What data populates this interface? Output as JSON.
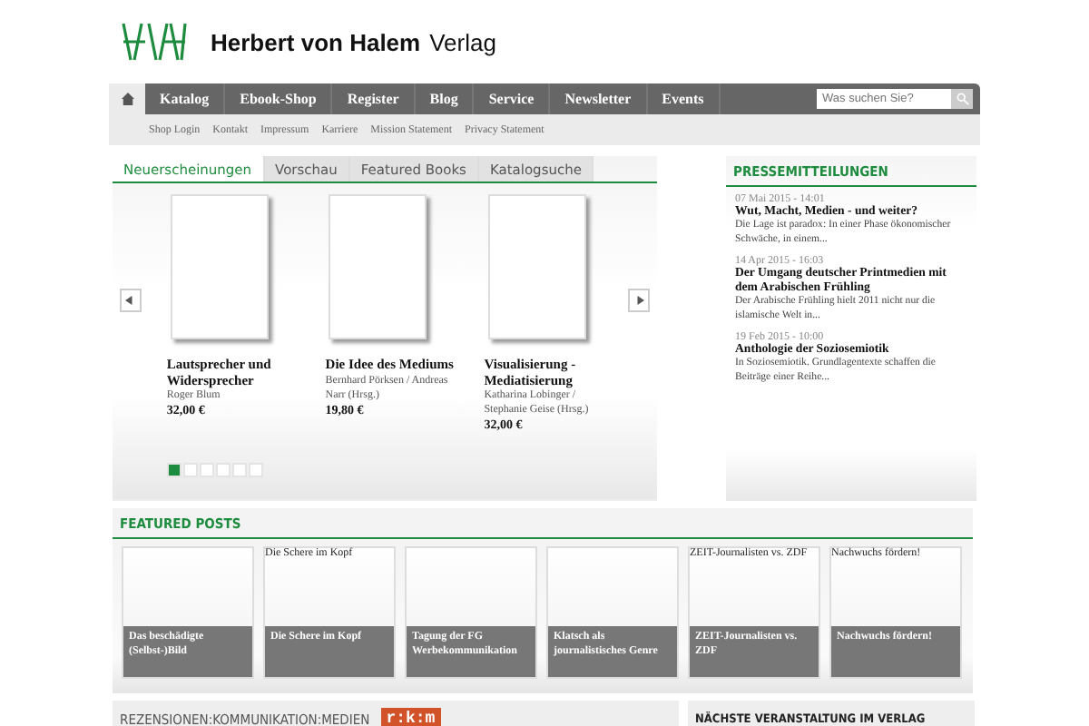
{
  "logo": {
    "name_bold": "Herbert von Halem",
    "name_light": "Verlag"
  },
  "nav": {
    "items": [
      {
        "label": "Katalog"
      },
      {
        "label": "Ebook-Shop"
      },
      {
        "label": "Register"
      },
      {
        "label": "Blog"
      },
      {
        "label": "Service"
      },
      {
        "label": "Newsletter"
      },
      {
        "label": "Events"
      }
    ],
    "search_placeholder": "Was suchen Sie?"
  },
  "subnav": [
    "Shop Login",
    "Kontakt",
    "Impressum",
    "Karriere",
    "Mission Statement",
    "Privacy Statement"
  ],
  "tabs": [
    {
      "label": "Neuerscheinungen",
      "selected": true
    },
    {
      "label": "Vorschau",
      "selected": false
    },
    {
      "label": "Featured Books",
      "selected": false
    },
    {
      "label": "Katalogsuche",
      "selected": false
    }
  ],
  "books": [
    {
      "title": "Lautsprecher und Widersprecher",
      "author": "Roger Blum",
      "price": "32,00 €"
    },
    {
      "title": "Die Idee des Mediums",
      "author": "Bernhard Pörksen / Andreas Narr (Hrsg.)",
      "price": "19,80 €"
    },
    {
      "title": "Visualisierung - Mediatisierung",
      "author": "Katharina Lobinger / Stephanie Geise (Hrsg.)",
      "price": "32,00 €"
    }
  ],
  "pager": [
    {
      "selected": true
    },
    {
      "selected": false
    },
    {
      "selected": false
    },
    {
      "selected": false
    },
    {
      "selected": false
    },
    {
      "selected": false
    }
  ],
  "press": {
    "title": "PRESSEMITTEILUNGEN",
    "items": [
      {
        "date": "07 Mai 2015 - 14:01",
        "title": "Wut, Macht, Medien - und weiter?",
        "text": "Die Lage ist paradox: In einer Phase ökonomischer Schwäche, in einem..."
      },
      {
        "date": "14 Apr 2015 - 16:03",
        "title": "Der Umgang deutscher Printmedien mit dem Arabischen Frühling",
        "text": "Der Arabische Frühling hielt 2011 nicht nur die islamische Welt in..."
      },
      {
        "date": "19 Feb 2015 - 10:00",
        "title": "Anthologie der Soziosemiotik",
        "text": "In Soziosemiotik. Grundlagentexte schaffen die Beiträge einer Reihe..."
      }
    ]
  },
  "featured": {
    "title": "FEATURED POSTS",
    "posts": [
      {
        "caption": "Das beschädigte (Selbst-)Bild"
      },
      {
        "alt": "Die Schere im Kopf",
        "caption": "Die Schere im Kopf"
      },
      {
        "caption": "Tagung der FG Werbekommunikation"
      },
      {
        "caption": "Klatsch als journalistisches Genre"
      },
      {
        "alt": "ZEIT-Journalisten vs. ZDF",
        "caption": "ZEIT-Journalisten vs. ZDF"
      },
      {
        "alt": "Nachwuchs fördern!",
        "caption": "Nachwuchs fördern!"
      }
    ]
  },
  "bottom": {
    "left_title": "REZENSIONEN:KOMMUNIKATION:MEDIEN",
    "badge": "r:k:m",
    "right_title": "NÄCHSTE VERANSTALTUNG IM VERLAG"
  }
}
